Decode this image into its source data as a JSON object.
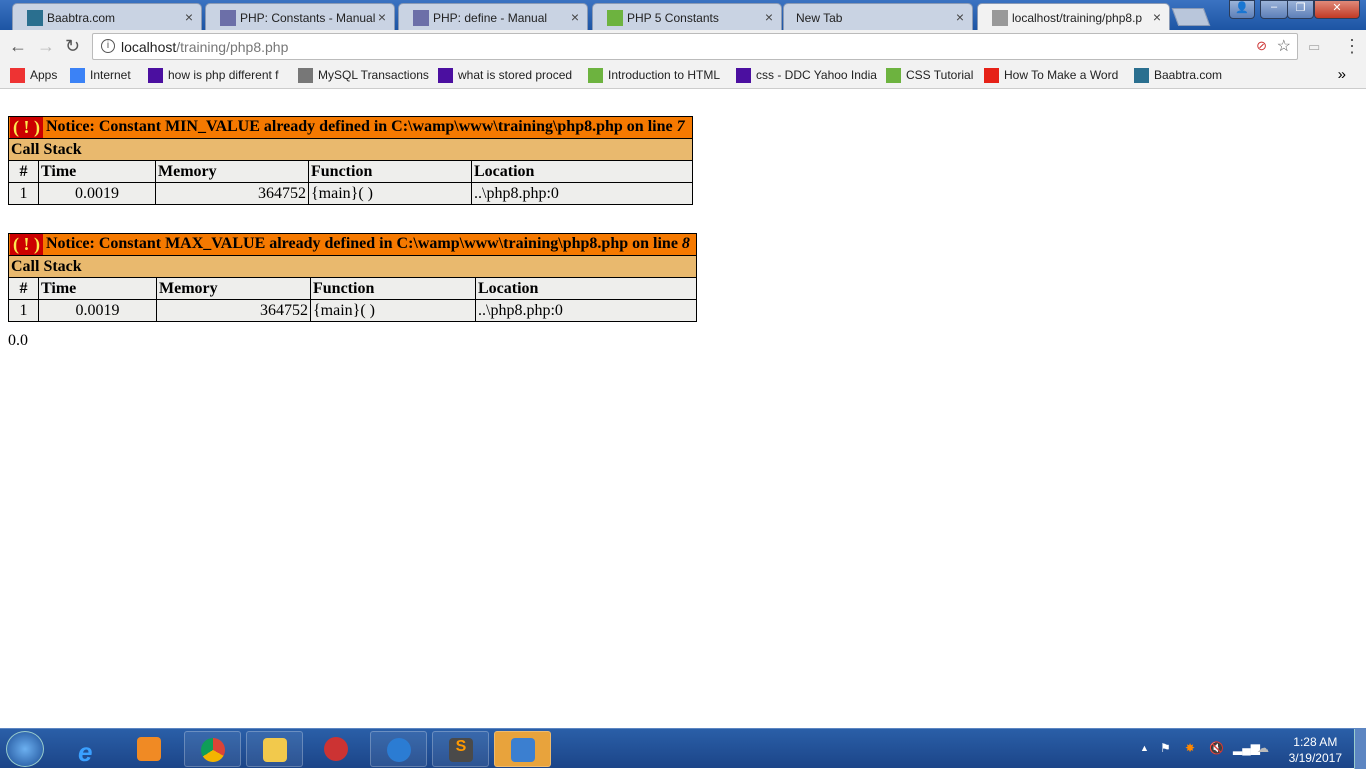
{
  "browser": {
    "tabs": [
      {
        "title": "Baabtra.com",
        "icon": "baabtra-icon",
        "color": "#2a6f8f"
      },
      {
        "title": "PHP: Constants - Manual",
        "icon": "php-icon",
        "color": "#6c6fa8"
      },
      {
        "title": "PHP: define - Manual",
        "icon": "php-icon",
        "color": "#6c6fa8"
      },
      {
        "title": "PHP 5 Constants",
        "icon": "w3-icon",
        "color": "#6db33f"
      },
      {
        "title": "New Tab",
        "icon": "",
        "color": ""
      },
      {
        "title": "localhost/training/php8.p",
        "icon": "page-icon",
        "color": "#999"
      }
    ],
    "address": {
      "host": "localhost",
      "path": "/training/php8.php"
    },
    "bookmarks": [
      {
        "label": "Apps",
        "icon": "apps-icon",
        "color": "#e33"
      },
      {
        "label": "Internet",
        "icon": "search-icon",
        "color": "#3b82f6"
      },
      {
        "label": "how is php different f",
        "icon": "yahoo-icon",
        "color": "#4b0fa0"
      },
      {
        "label": "MySQL Transactions",
        "icon": "mysql-icon",
        "color": "#777"
      },
      {
        "label": "what is stored proced",
        "icon": "yahoo-icon",
        "color": "#4b0fa0"
      },
      {
        "label": "Introduction to HTML",
        "icon": "w3-icon",
        "color": "#6db33f"
      },
      {
        "label": "css - DDC Yahoo India",
        "icon": "yahoo-icon",
        "color": "#4b0fa0"
      },
      {
        "label": "CSS Tutorial",
        "icon": "w3-icon",
        "color": "#6db33f"
      },
      {
        "label": "How To Make a Word",
        "icon": "youtube-icon",
        "color": "#e62117"
      },
      {
        "label": "Baabtra.com",
        "icon": "baabtra-icon",
        "color": "#2a6f8f"
      }
    ],
    "overflow": "»"
  },
  "notices": [
    {
      "bang": "( ! )",
      "message": "Notice: Constant MIN_VALUE already defined in C:\\wamp\\www\\training\\php8.php on line ",
      "line": "7",
      "call_stack": "Call Stack",
      "columns": [
        "#",
        "Time",
        "Memory",
        "Function",
        "Location"
      ],
      "rows": [
        [
          "1",
          "0.0019",
          "364752",
          "{main}( )",
          "..\\php8.php:0"
        ]
      ]
    },
    {
      "bang": "( ! )",
      "message": "Notice: Constant MAX_VALUE already defined in C:\\wamp\\www\\training\\php8.php on line ",
      "line": "8",
      "call_stack": "Call Stack",
      "columns": [
        "#",
        "Time",
        "Memory",
        "Function",
        "Location"
      ],
      "rows": [
        [
          "1",
          "0.0019",
          "364752",
          "{main}( )",
          "..\\php8.php:0"
        ]
      ]
    }
  ],
  "output": "0.0",
  "taskbar": {
    "time": "1:28 AM",
    "date": "3/19/2017"
  }
}
